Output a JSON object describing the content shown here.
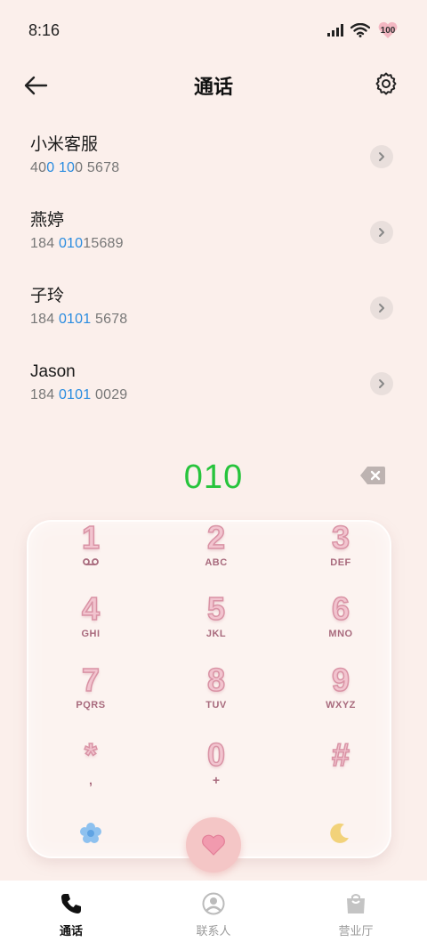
{
  "status_bar": {
    "time": "8:16",
    "battery": "100"
  },
  "header": {
    "title": "通话"
  },
  "contacts": [
    {
      "name": "小米客服",
      "number_parts": [
        "40",
        "0 10",
        "0 5678"
      ]
    },
    {
      "name": "燕婷",
      "number_parts": [
        "184 ",
        "010",
        "15689"
      ]
    },
    {
      "name": "子玲",
      "number_parts": [
        "184 ",
        "0101",
        " 5678"
      ]
    },
    {
      "name": "Jason",
      "number_parts": [
        "184 ",
        "0101",
        " 0029"
      ]
    }
  ],
  "dialer": {
    "number": "010"
  },
  "keypad": {
    "keys": [
      {
        "digit": "1",
        "letters": ""
      },
      {
        "digit": "2",
        "letters": "ABC"
      },
      {
        "digit": "3",
        "letters": "DEF"
      },
      {
        "digit": "4",
        "letters": "GHI"
      },
      {
        "digit": "5",
        "letters": "JKL"
      },
      {
        "digit": "6",
        "letters": "MNO"
      },
      {
        "digit": "7",
        "letters": "PQRS"
      },
      {
        "digit": "8",
        "letters": "TUV"
      },
      {
        "digit": "9",
        "letters": "WXYZ"
      },
      {
        "digit": "*",
        "letters": ","
      },
      {
        "digit": "0",
        "letters": "+"
      },
      {
        "digit": "#",
        "letters": ""
      }
    ]
  },
  "bottom_nav": [
    {
      "label": "通话",
      "icon": "phone-icon",
      "active": true
    },
    {
      "label": "联系人",
      "icon": "person-icon",
      "active": false
    },
    {
      "label": "营业厅",
      "icon": "bag-icon",
      "active": false
    }
  ],
  "colors": {
    "background": "#fbefeb",
    "highlight": "#2a8ce0",
    "dial_number": "#27c43c",
    "call_button": "#f4c6c6"
  }
}
